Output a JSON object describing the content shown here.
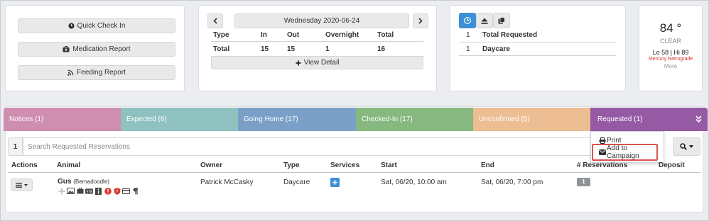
{
  "quick_buttons": {
    "check_in": "Quick Check In",
    "medication": "Medication Report",
    "feeding": "Feeding Report"
  },
  "date_card": {
    "date": "Wednesday 2020-06-24",
    "headers": [
      "Type",
      "In",
      "Out",
      "Overnight",
      "Total"
    ],
    "total_row": [
      "Total",
      "15",
      "15",
      "1",
      "16"
    ],
    "view_detail": "View Detail"
  },
  "requests_card": {
    "rows": [
      {
        "count": "1",
        "label": "Total Requested"
      },
      {
        "count": "1",
        "label": "Daycare"
      }
    ]
  },
  "weather": {
    "temp": "84 °",
    "condition": "CLEAR",
    "lohi": "Lo 58 | Hi 89",
    "note": "Mercury Retrograde",
    "more": "More"
  },
  "tabs": [
    {
      "label": "Notices (1)",
      "color": "#cf8db0"
    },
    {
      "label": "Expected (6)",
      "color": "#8ec1c0"
    },
    {
      "label": "Going Home (17)",
      "color": "#7ba0c8"
    },
    {
      "label": "Checked-In (17)",
      "color": "#86b880"
    },
    {
      "label": "Unconfirmed (0)",
      "color": "#edbd94"
    },
    {
      "label": "Requested (1)",
      "color": "#965aa5"
    }
  ],
  "search": {
    "page_number": "1",
    "placeholder": "Search Requested Reservations"
  },
  "dropdown": {
    "print": "Print",
    "add_campaign": "Add to Campaign"
  },
  "table": {
    "headers": [
      "Actions",
      "Animal",
      "Owner",
      "Type",
      "Services",
      "Start",
      "End",
      "# Reservations",
      "Deposit"
    ],
    "row": {
      "animal_name": "Gus",
      "animal_breed": "(Bernadoodle)",
      "owner": "Patrick McCasky",
      "type": "Daycare",
      "start": "Sat, 06/20, 10:00 am",
      "end": "Sat, 06/20, 7:00 pm",
      "reservations": "1"
    }
  }
}
